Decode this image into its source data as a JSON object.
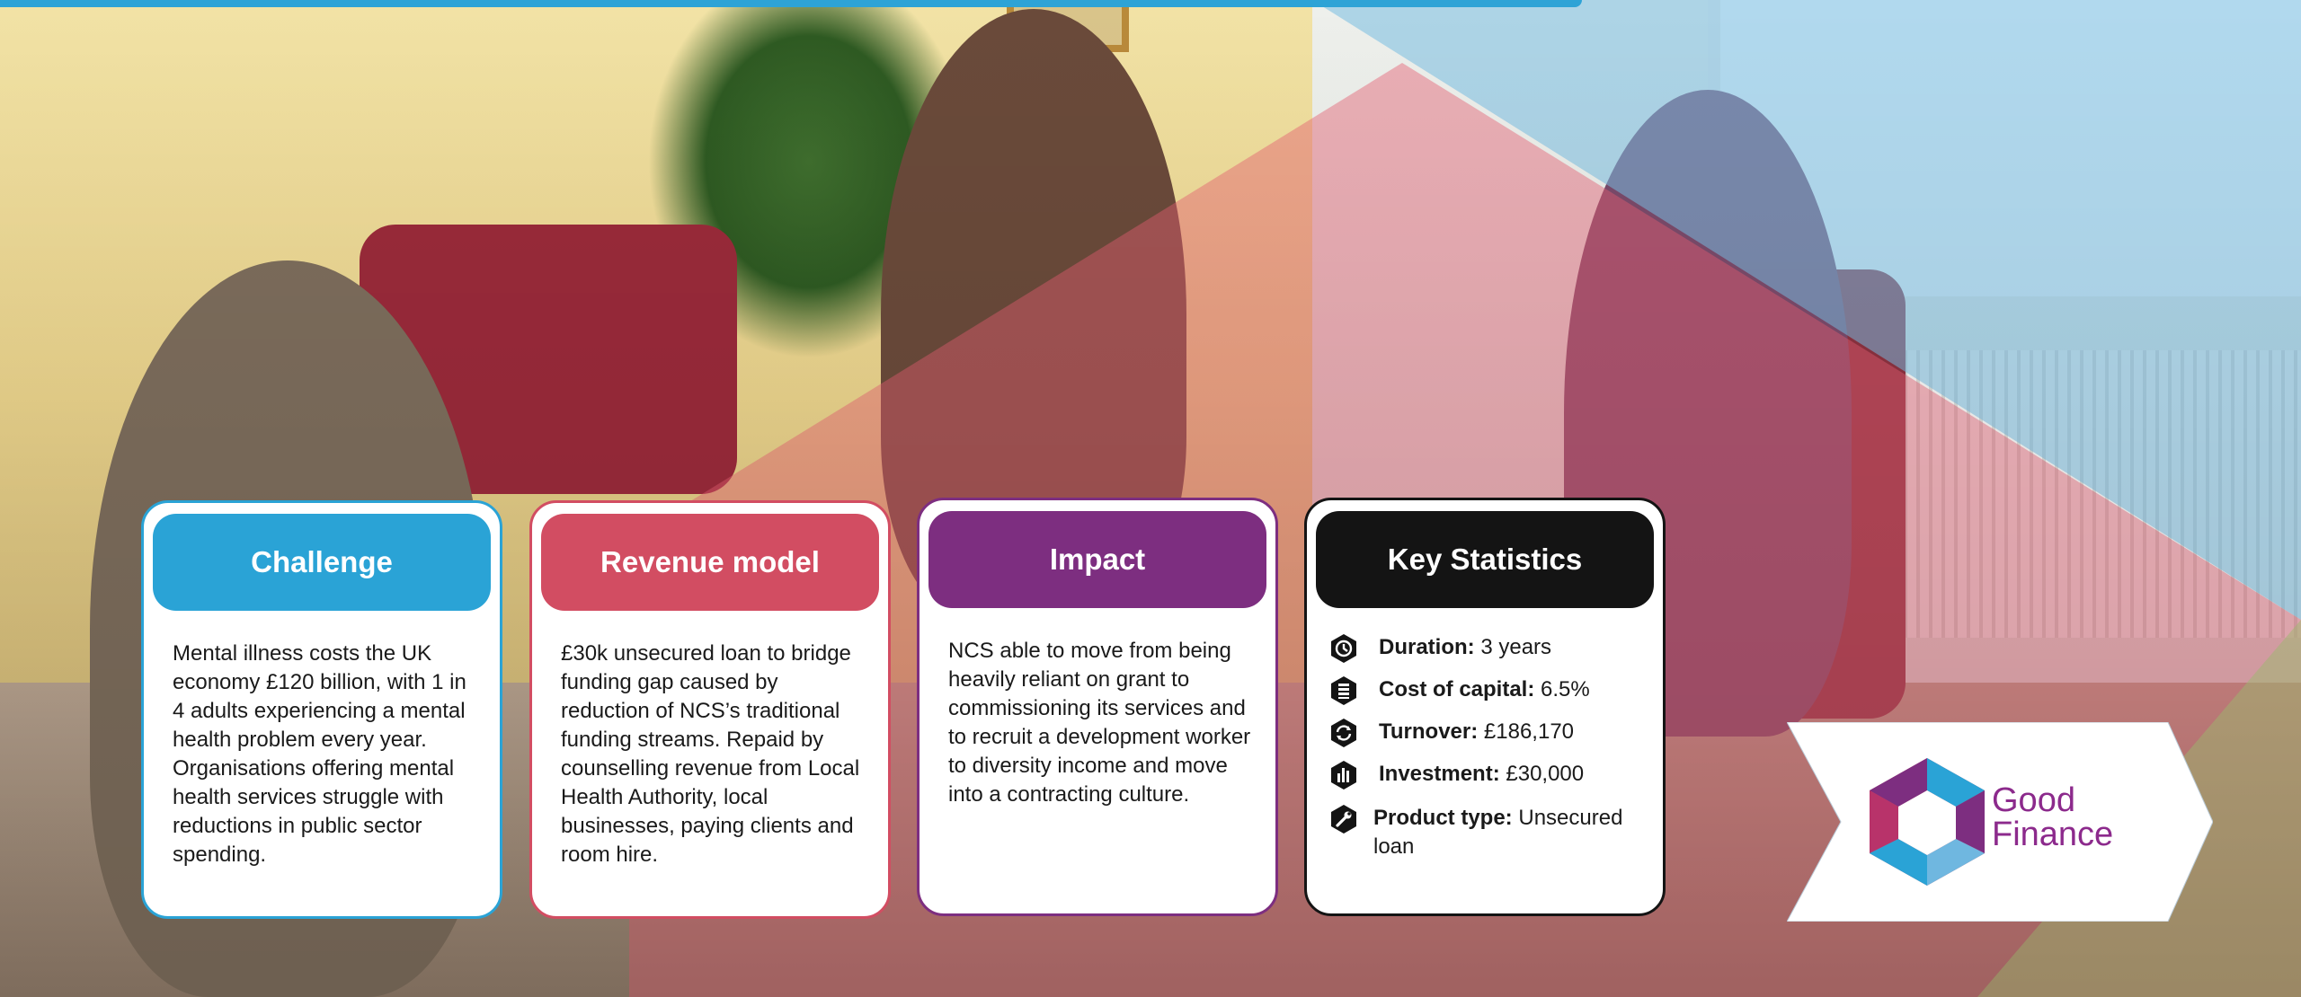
{
  "cards": {
    "challenge": {
      "title": "Challenge",
      "body": "Mental illness costs the UK economy £120 billion, with 1 in 4 adults experiencing a mental health problem every year. Organisations offering mental health services struggle with reductions in public sector spending."
    },
    "revenue": {
      "title": "Revenue model",
      "body": "£30k unsecured loan to bridge funding gap caused by reduction of NCS’s traditional funding streams. Repaid by counselling revenue from Local Health Authority, local businesses, paying clients and room hire."
    },
    "impact": {
      "title": "Impact",
      "body": "NCS able to move from being heavily reliant on grant to commissioning its services and to recruit a development worker to diversity income and move into a contracting culture."
    },
    "stats": {
      "title": "Key Statistics",
      "items": [
        {
          "label": "Duration:",
          "value": "3 years",
          "icon": "clock-icon"
        },
        {
          "label": "Cost of capital:",
          "value": "6.5%",
          "icon": "coin-stack-icon"
        },
        {
          "label": "Turnover:",
          "value": "£186,170",
          "icon": "refresh-icon"
        },
        {
          "label": "Investment:",
          "value": "£30,000",
          "icon": "bar-chart-icon"
        },
        {
          "label": "Product type:",
          "value": "Unsecured loan",
          "icon": "wrench-icon"
        }
      ]
    }
  },
  "logo": {
    "line1": "Good",
    "line2": "Finance"
  },
  "colors": {
    "challenge": "#2aa3d6",
    "revenue": "#d24d62",
    "impact": "#7d2e80",
    "stats": "#141414",
    "logo_text": "#8c2a8c"
  }
}
